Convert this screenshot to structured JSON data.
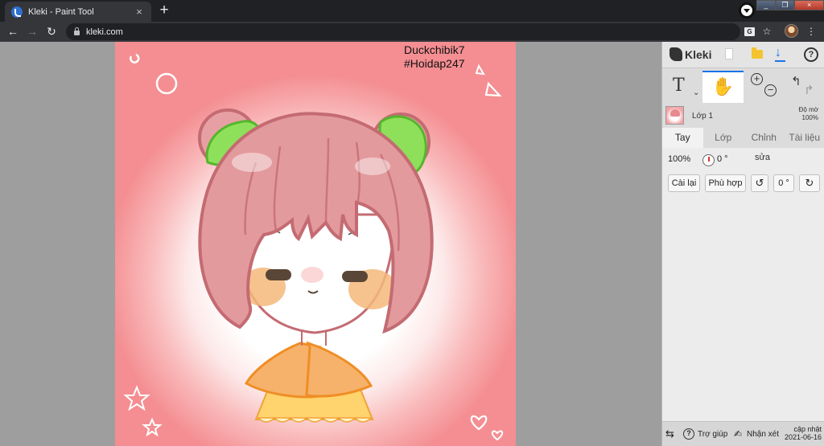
{
  "browser": {
    "tab_title": "Kleki - Paint Tool",
    "tab_close": "×",
    "new_tab": "+",
    "url": "kleki.com",
    "window_controls": [
      "_",
      "❐",
      "×"
    ]
  },
  "nav": {
    "back": "←",
    "forward": "→",
    "reload": "↻",
    "translate": "G",
    "star": "☆",
    "menu": "⋮"
  },
  "canvas": {
    "signature_line1": "Duckchibik7",
    "signature_line2": "#Hoidap247",
    "colors": {
      "hair": "#e39a9d",
      "hair_outline": "#c46b72",
      "leaf": "#8ee05a",
      "cheek": "#f0a35a",
      "cape": "#f6b26b",
      "dress": "#ffd36e",
      "bg_edge": "#f48e92"
    }
  },
  "panel": {
    "logo": "Kleki",
    "icons": [
      "new-file-icon",
      "folder-icon",
      "download-icon",
      "help-icon"
    ],
    "tools": {
      "text_tool": "T",
      "text_caret": "⌄",
      "hand_tool": "✋",
      "zoom_in": "+",
      "zoom_out": "−",
      "undo": "↰",
      "redo": "↱"
    },
    "layer": {
      "name": "Lớp 1",
      "opacity_label": "Độ mờ",
      "opacity_value": "100%"
    },
    "tabs": [
      "Tay",
      "Lớp",
      "Chỉnh",
      "Tài liệu"
    ],
    "hand_tab": {
      "zoom": "100%",
      "rotation": "0 °",
      "edit": "sửa",
      "reset_button": "Cài lại",
      "fit_button": "Phù hợp",
      "rotate_left": "↺",
      "rotation_field": "0 °",
      "rotate_right": "↻"
    },
    "bottom": {
      "swap": "⇆",
      "help_mark": "?",
      "help": "Trợ giúp",
      "feedback_icon": "✍",
      "feedback": "Nhận xét",
      "update_label": "cập nhật",
      "update_date": "2021-06-16"
    }
  }
}
